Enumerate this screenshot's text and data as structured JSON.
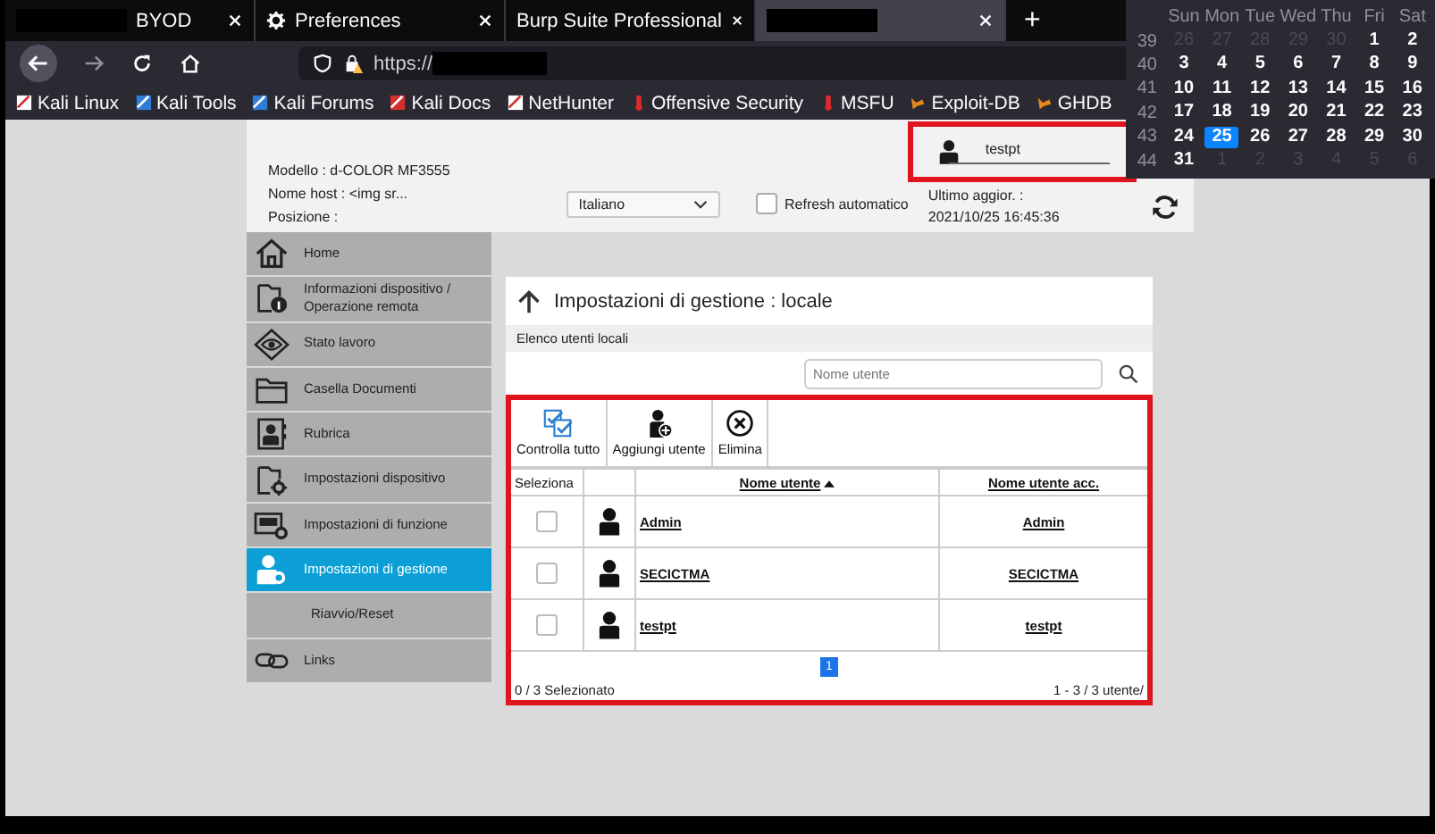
{
  "browser": {
    "tabs": [
      {
        "kind": "page",
        "label": "BYOD",
        "redacted": true,
        "selected": false
      },
      {
        "kind": "settings",
        "label": "Preferences",
        "redacted": false,
        "selected": false
      },
      {
        "kind": "page",
        "label": "Burp Suite Professional",
        "redacted": false,
        "selected": false
      },
      {
        "kind": "page",
        "redacted": true,
        "selected": true
      }
    ],
    "new_tab": "+",
    "url": "https://",
    "url_redacted": true,
    "bookmarks": [
      "Kali Linux",
      "Kali Tools",
      "Kali Forums",
      "Kali Docs",
      "NetHunter",
      "Offensive Security",
      "MSFU",
      "Exploit-DB",
      "GHDB"
    ]
  },
  "calendar": {
    "weekdays": [
      "Sun",
      "Mon",
      "Tue",
      "Wed",
      "Thu",
      "Fri",
      "Sat"
    ],
    "weeks": [
      {
        "number": "39",
        "days": [
          {
            "label": "26",
            "muted": true,
            "selected": false
          },
          {
            "label": "27",
            "muted": true,
            "selected": false
          },
          {
            "label": "28",
            "muted": true,
            "selected": false
          },
          {
            "label": "29",
            "muted": true,
            "selected": false
          },
          {
            "label": "30",
            "muted": true,
            "selected": false
          },
          {
            "label": "1",
            "muted": false,
            "selected": false
          },
          {
            "label": "2",
            "muted": false,
            "selected": false
          }
        ]
      },
      {
        "number": "40",
        "days": [
          {
            "label": "3",
            "muted": false,
            "selected": false
          },
          {
            "label": "4",
            "muted": false,
            "selected": false
          },
          {
            "label": "5",
            "muted": false,
            "selected": false
          },
          {
            "label": "6",
            "muted": false,
            "selected": false
          },
          {
            "label": "7",
            "muted": false,
            "selected": false
          },
          {
            "label": "8",
            "muted": false,
            "selected": false
          },
          {
            "label": "9",
            "muted": false,
            "selected": false
          }
        ]
      },
      {
        "number": "41",
        "days": [
          {
            "label": "10",
            "muted": false,
            "selected": false
          },
          {
            "label": "11",
            "muted": false,
            "selected": false
          },
          {
            "label": "12",
            "muted": false,
            "selected": false
          },
          {
            "label": "13",
            "muted": false,
            "selected": false
          },
          {
            "label": "14",
            "muted": false,
            "selected": false
          },
          {
            "label": "15",
            "muted": false,
            "selected": false
          },
          {
            "label": "16",
            "muted": false,
            "selected": false
          }
        ]
      },
      {
        "number": "42",
        "days": [
          {
            "label": "17",
            "muted": false,
            "selected": false
          },
          {
            "label": "18",
            "muted": false,
            "selected": false
          },
          {
            "label": "19",
            "muted": false,
            "selected": false
          },
          {
            "label": "20",
            "muted": false,
            "selected": false
          },
          {
            "label": "21",
            "muted": false,
            "selected": false
          },
          {
            "label": "22",
            "muted": false,
            "selected": false
          },
          {
            "label": "23",
            "muted": false,
            "selected": false
          }
        ]
      },
      {
        "number": "43",
        "days": [
          {
            "label": "24",
            "muted": false,
            "selected": false
          },
          {
            "label": "25",
            "muted": false,
            "selected": true
          },
          {
            "label": "26",
            "muted": false,
            "selected": false
          },
          {
            "label": "27",
            "muted": false,
            "selected": false
          },
          {
            "label": "28",
            "muted": false,
            "selected": false
          },
          {
            "label": "29",
            "muted": false,
            "selected": false
          },
          {
            "label": "30",
            "muted": false,
            "selected": false
          }
        ]
      },
      {
        "number": "44",
        "days": [
          {
            "label": "31",
            "muted": false,
            "selected": false
          },
          {
            "label": "1",
            "muted": true,
            "selected": false
          },
          {
            "label": "2",
            "muted": true,
            "selected": false
          },
          {
            "label": "3",
            "muted": true,
            "selected": false
          },
          {
            "label": "4",
            "muted": true,
            "selected": false
          },
          {
            "label": "5",
            "muted": true,
            "selected": false
          },
          {
            "label": "6",
            "muted": true,
            "selected": false
          }
        ]
      }
    ]
  },
  "header": {
    "info_lines": [
      "Modello : d-COLOR MF3555",
      "Nome host : <img sr...",
      "Posizione :"
    ],
    "language": "Italiano",
    "auto_refresh": {
      "label": "Refresh automatico",
      "checked": false
    },
    "updated_label": "Ultimo aggior. :",
    "updated": "2021/10/25 16:45:36",
    "user": "testpt"
  },
  "sidebar": [
    {
      "kind": "item",
      "label": "Home",
      "selected": false
    },
    {
      "kind": "item",
      "label": "Informazioni dispositivo / Operazione remota",
      "selected": false
    },
    {
      "kind": "item",
      "label": "Stato lavoro",
      "selected": false
    },
    {
      "kind": "item",
      "label": "Casella Documenti",
      "selected": false
    },
    {
      "kind": "item",
      "label": "Rubrica",
      "selected": false
    },
    {
      "kind": "item",
      "label": "Impostazioni dispositivo",
      "selected": false
    },
    {
      "kind": "item",
      "label": "Impostazioni di funzione",
      "selected": false
    },
    {
      "kind": "item",
      "label": "Impostazioni di gestione",
      "selected": true
    },
    {
      "kind": "subitem",
      "label": "Riavvio/Reset",
      "selected": false
    },
    {
      "kind": "item",
      "label": "Links",
      "selected": false
    }
  ],
  "panel": {
    "title": "Impostazioni di gestione : locale",
    "section": "Elenco utenti locali",
    "search_placeholder": "Nome utente",
    "actions": [
      "Controlla tutto",
      "Aggiungi utente",
      "Elimina"
    ],
    "columns": [
      "Seleziona",
      "Nome utente",
      "Nome utente acc."
    ],
    "rows": [
      {
        "name": "Admin",
        "login": "Admin",
        "checked": false
      },
      {
        "name": "SECICTMA",
        "login": "SECICTMA",
        "checked": false
      },
      {
        "name": "testpt",
        "login": "testpt",
        "checked": false
      }
    ],
    "pages": [
      {
        "label": "1",
        "selected": true
      }
    ],
    "selected_count": "0 / 3 Selezionato",
    "range": "1 - 3 / 3 utente/"
  }
}
